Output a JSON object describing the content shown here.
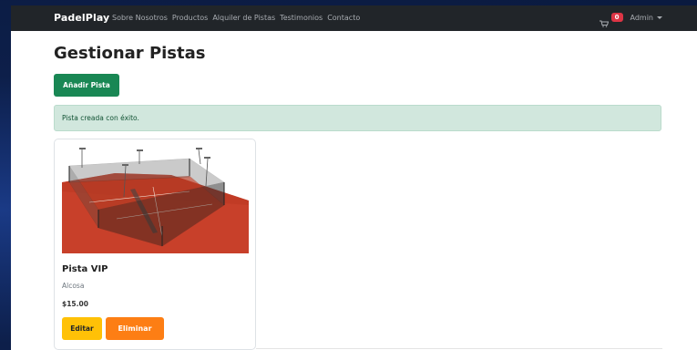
{
  "navbar": {
    "brand": "PadelPlay",
    "links": [
      "Sobre Nosotros",
      "Productos",
      "Alquiler de Pistas",
      "Testimonios",
      "Contacto"
    ],
    "cart_count": "0",
    "user_menu_label": "Admin"
  },
  "main": {
    "title": "Gestionar Pistas",
    "add_button_label": "Añadir Pista",
    "alert_message": "Pista creada con éxito."
  },
  "courts": [
    {
      "name": "Pista VIP",
      "location": "Alcosa",
      "price": "$15.00",
      "edit_label": "Editar",
      "delete_label": "Eliminar"
    }
  ],
  "colors": {
    "navbar_bg": "#212529",
    "success": "#198754",
    "alert_bg": "#d1e7dd",
    "warning": "#ffc107",
    "orange": "#fd7e14",
    "badge": "#dc3545",
    "court_floor": "#c8402a"
  }
}
